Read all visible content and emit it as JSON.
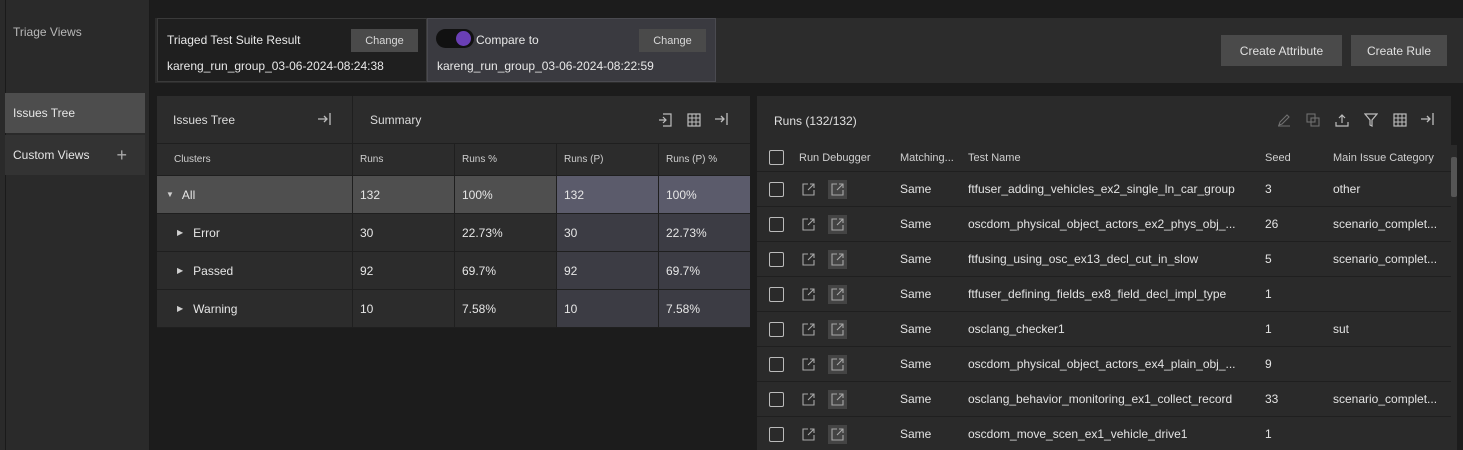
{
  "sidebar": {
    "title": "Triage Views",
    "items": [
      {
        "label": "Issues Tree"
      },
      {
        "label": "Custom Views"
      }
    ]
  },
  "topbar": {
    "triaged_label": "Triaged Test Suite Result",
    "triaged_value": "kareng_run_group_03-06-2024-08:24:38",
    "compare_label": "Compare to",
    "compare_value": "kareng_run_group_03-06-2024-08:22:59",
    "change_label": "Change",
    "create_attribute_label": "Create Attribute",
    "create_rule_label": "Create Rule"
  },
  "issues_tree": {
    "title": "Issues Tree",
    "summary_title": "Summary",
    "columns": [
      "Clusters",
      "Runs",
      "Runs %",
      "Runs (P)",
      "Runs (P) %"
    ],
    "rows": [
      {
        "name": "All",
        "runs": "132",
        "pct": "100%",
        "runs_p": "132",
        "pct_p": "100%"
      },
      {
        "name": "Error",
        "runs": "30",
        "pct": "22.73%",
        "runs_p": "30",
        "pct_p": "22.73%"
      },
      {
        "name": "Passed",
        "runs": "92",
        "pct": "69.7%",
        "runs_p": "92",
        "pct_p": "69.7%"
      },
      {
        "name": "Warning",
        "runs": "10",
        "pct": "7.58%",
        "runs_p": "10",
        "pct_p": "7.58%"
      }
    ]
  },
  "runs": {
    "title": "Runs (132/132)",
    "columns": [
      "Run Debugger",
      "Matching...",
      "Test Name",
      "Seed",
      "Main Issue Category"
    ],
    "rows": [
      {
        "matching": "Same",
        "name": "ftfuser_adding_vehicles_ex2_single_ln_car_group",
        "seed": "3",
        "category": "other"
      },
      {
        "matching": "Same",
        "name": "oscdom_physical_object_actors_ex2_phys_obj_...",
        "seed": "26",
        "category": "scenario_complet..."
      },
      {
        "matching": "Same",
        "name": "ftfusing_using_osc_ex13_decl_cut_in_slow",
        "seed": "5",
        "category": "scenario_complet..."
      },
      {
        "matching": "Same",
        "name": "ftfuser_defining_fields_ex8_field_decl_impl_type",
        "seed": "1",
        "category": ""
      },
      {
        "matching": "Same",
        "name": "osclang_checker1",
        "seed": "1",
        "category": "sut"
      },
      {
        "matching": "Same",
        "name": "oscdom_physical_object_actors_ex4_plain_obj_...",
        "seed": "9",
        "category": ""
      },
      {
        "matching": "Same",
        "name": "osclang_behavior_monitoring_ex1_collect_record",
        "seed": "33",
        "category": "scenario_complet..."
      },
      {
        "matching": "Same",
        "name": "oscdom_move_scen_ex1_vehicle_drive1",
        "seed": "1",
        "category": ""
      }
    ]
  }
}
